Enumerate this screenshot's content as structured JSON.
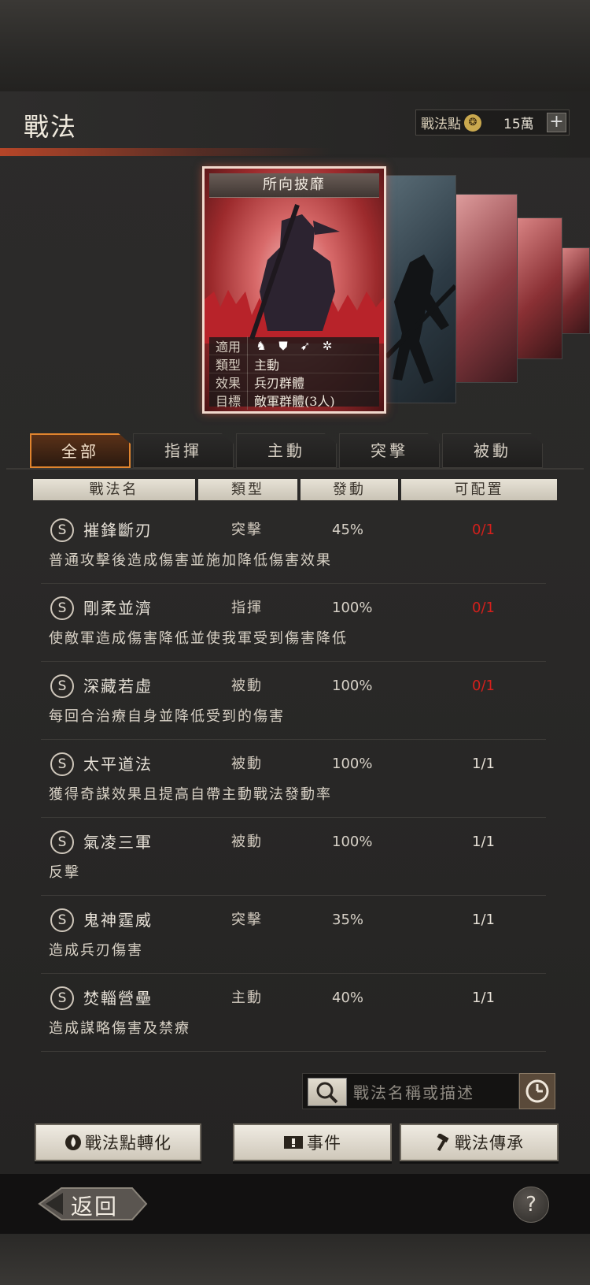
{
  "header": {
    "title": "戰法",
    "points_label": "戰法點",
    "points_value": "15萬",
    "plus": "+"
  },
  "card": {
    "name": "所向披靡",
    "labels": {
      "apply": "適用",
      "type": "類型",
      "effect": "效果",
      "target": "目標"
    },
    "type": "主動",
    "effect": "兵刃群體",
    "target": "敵軍群體(3人)",
    "apply_icons": [
      "cavalry-icon",
      "shield-icon",
      "bow-icon",
      "wheel-icon"
    ]
  },
  "tabs": [
    "全部",
    "指揮",
    "主動",
    "突擊",
    "被動"
  ],
  "active_tab": "全部",
  "columns": [
    "戰法名",
    "類型",
    "發動",
    "可配置"
  ],
  "rows": [
    {
      "badge": "S",
      "name": "摧鋒斷刃",
      "type": "突擊",
      "rate": "45%",
      "slot": "0/1",
      "slot_full": true,
      "desc": "普通攻擊後造成傷害並施加降低傷害效果"
    },
    {
      "badge": "S",
      "name": "剛柔並濟",
      "type": "指揮",
      "rate": "100%",
      "slot": "0/1",
      "slot_full": true,
      "desc": "使敵軍造成傷害降低並使我軍受到傷害降低"
    },
    {
      "badge": "S",
      "name": "深藏若虛",
      "type": "被動",
      "rate": "100%",
      "slot": "0/1",
      "slot_full": true,
      "desc": "每回合治療自身並降低受到的傷害"
    },
    {
      "badge": "S",
      "name": "太平道法",
      "type": "被動",
      "rate": "100%",
      "slot": "1/1",
      "slot_full": false,
      "desc": "獲得奇謀效果且提高自帶主動戰法發動率"
    },
    {
      "badge": "S",
      "name": "氣凌三軍",
      "type": "被動",
      "rate": "100%",
      "slot": "1/1",
      "slot_full": false,
      "desc": "反擊"
    },
    {
      "badge": "S",
      "name": "鬼神霆威",
      "type": "突擊",
      "rate": "35%",
      "slot": "1/1",
      "slot_full": false,
      "desc": "造成兵刃傷害"
    },
    {
      "badge": "S",
      "name": "焚輜營壘",
      "type": "主動",
      "rate": "40%",
      "slot": "1/1",
      "slot_full": false,
      "desc": "造成謀略傷害及禁療"
    }
  ],
  "search": {
    "placeholder": "戰法名稱或描述"
  },
  "buttons": {
    "convert": "戰法點轉化",
    "event": "事件",
    "inherit": "戰法傳承"
  },
  "footer": {
    "back": "返回",
    "help": "?"
  },
  "colors": {
    "accent": "#e0842e",
    "slot_full": "#d4201c"
  }
}
